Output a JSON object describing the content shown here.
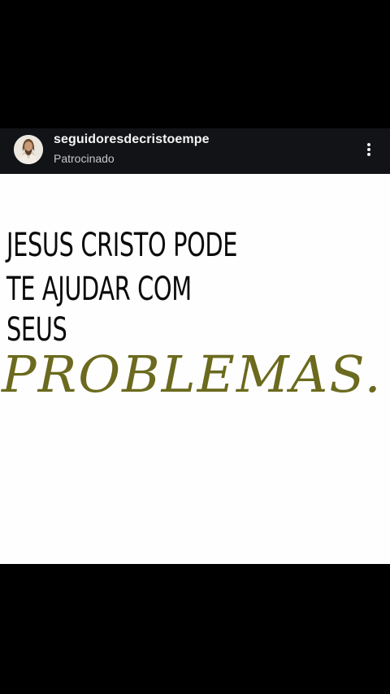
{
  "post": {
    "account_name": "seguidoresdecristoempe",
    "sponsored_label": "Patrocinado",
    "avatar_icon": "profile-avatar-icon",
    "more_icon": "more-vertical-icon"
  },
  "media": {
    "headline_lines": [
      "JESUS CRISTO PODE",
      "TE AJUDAR COM",
      "SEUS"
    ],
    "script_word": "PROBLEMAS.",
    "colors": {
      "background": "#fefefe",
      "headline": "#0a0a0a",
      "script": "#6b6a1e",
      "header_bar": "#111316",
      "screen": "#000000"
    }
  }
}
